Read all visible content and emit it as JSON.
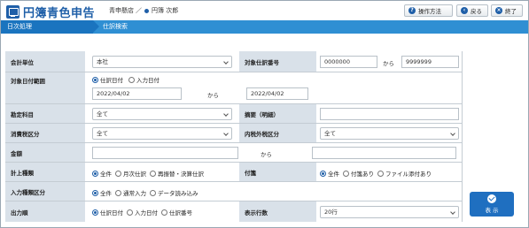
{
  "header": {
    "app_title": "円簿青色申告",
    "store_name": "青申懸店",
    "separator": "／",
    "user_name": "円簿 次郎",
    "help_label": "操作方法",
    "back_label": "戻る",
    "close_label": "終了"
  },
  "breadcrumb": {
    "parent": "日次処理",
    "current": "仕訳検索"
  },
  "form": {
    "accounting_unit": {
      "label": "会計単位",
      "value": "本社"
    },
    "journal_number": {
      "label": "対象仕訳番号",
      "from": "0000000",
      "sep": "から",
      "to": "9999999"
    },
    "date_range": {
      "label": "対象日付範囲",
      "options": [
        "仕訳日付",
        "入力日付"
      ],
      "selected": "仕訳日付",
      "from": "2022/04/02",
      "sep": "から",
      "to": "2022/04/02"
    },
    "account": {
      "label": "勘定科目",
      "value": "全て"
    },
    "memo": {
      "label": "摘要（明細）",
      "value": ""
    },
    "consumption_tax": {
      "label": "消費税区分",
      "value": "全て"
    },
    "tax_inclusive": {
      "label": "内税外税区分",
      "value": "全て"
    },
    "amount": {
      "label": "金額",
      "from": "",
      "sep": "から",
      "to": ""
    },
    "entry_type": {
      "label": "計上種類",
      "options": [
        "全件",
        "月次仕訳",
        "再振替・決算仕訳"
      ],
      "selected": "全件"
    },
    "attachment": {
      "label": "付箋",
      "options": [
        "全件",
        "付箋あり",
        "ファイル添付あり"
      ],
      "selected": "全件"
    },
    "input_type": {
      "label": "入力種類区分",
      "options": [
        "全件",
        "通常入力",
        "データ読み込み"
      ],
      "selected": "全件"
    },
    "sort_order": {
      "label": "出力順",
      "options": [
        "仕訳日付",
        "入力日付",
        "仕訳番号"
      ],
      "selected": "仕訳日付"
    },
    "row_count": {
      "label": "表示行数",
      "value": "20行"
    }
  },
  "actions": {
    "show_label": "表 示"
  },
  "colors": {
    "accent": "#1f5fa8",
    "bar": "#2f8fd3",
    "label_bg": "#d9e1e9"
  }
}
